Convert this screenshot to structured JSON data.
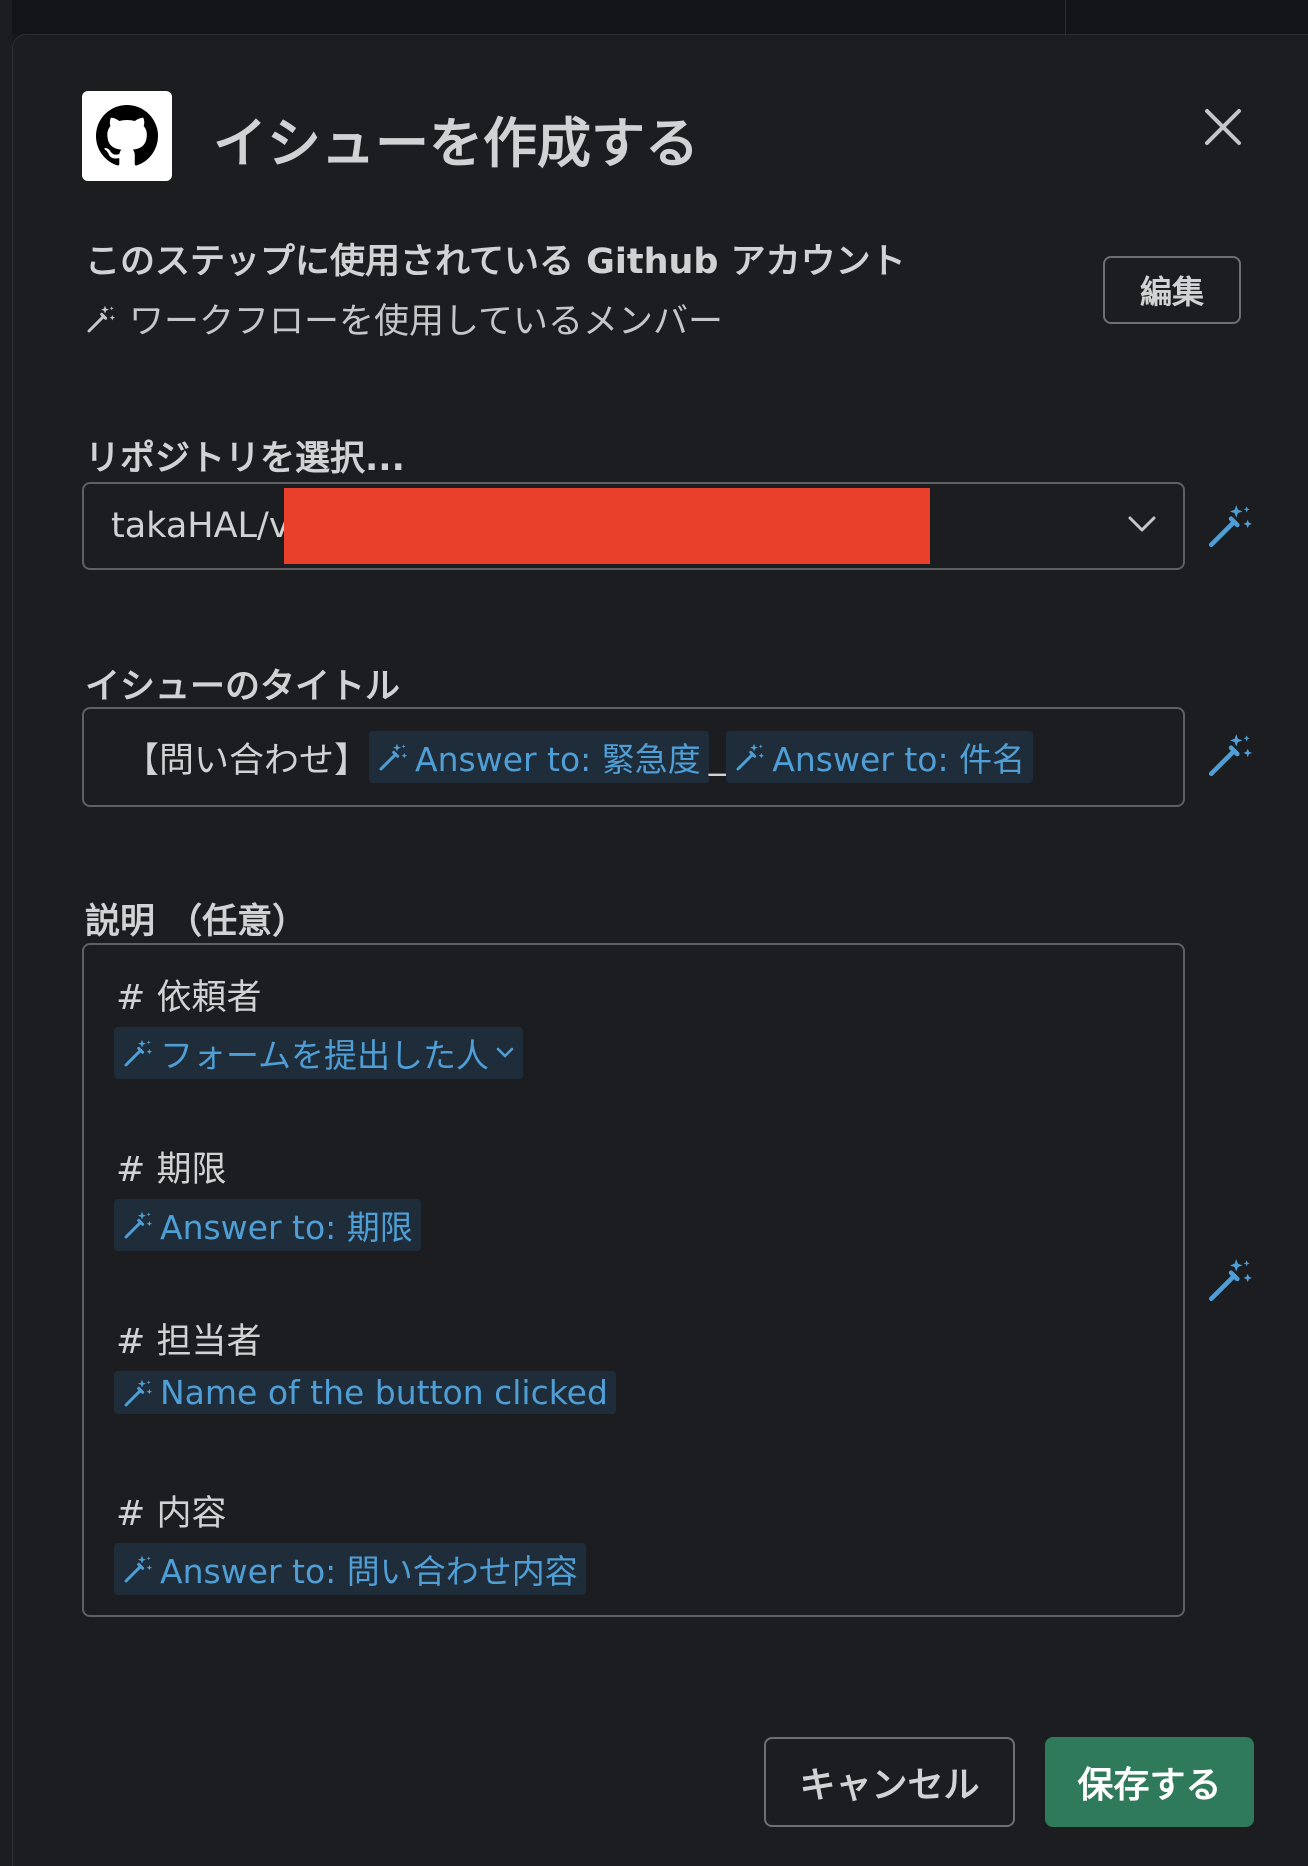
{
  "modal": {
    "title": "イシューを作成する",
    "logo_icon": "github-logo-icon",
    "close_icon": "close-icon"
  },
  "account": {
    "heading": "このステップに使用されている Github アカウント",
    "value": "ワークフローを使用しているメンバー",
    "edit_label": "編集"
  },
  "repository": {
    "label": "リポジトリを選択...",
    "value": "takaHAL/v"
  },
  "issue_title": {
    "label": "イシューのタイトル",
    "prefix": "【問い合わせ】",
    "token1": "Answer to: 緊急度",
    "separator": "_",
    "token2": "Answer to: 件名"
  },
  "description": {
    "label": "説明 （任意）",
    "sections": [
      {
        "heading": "# 依頼者",
        "token": "フォームを提出した人"
      },
      {
        "heading": "# 期限",
        "token": "Answer to: 期限"
      },
      {
        "heading": "# 担当者",
        "token": "Name of the button clicked"
      },
      {
        "heading": "# 内容",
        "token": "Answer to: 問い合わせ内容"
      }
    ]
  },
  "footer": {
    "cancel_label": "キャンセル",
    "save_label": "保存する"
  },
  "colors": {
    "background": "#1b1d21",
    "accent_token": "#4f9fd6",
    "save_button": "#2f7a5a",
    "redaction": "#e8402a"
  }
}
